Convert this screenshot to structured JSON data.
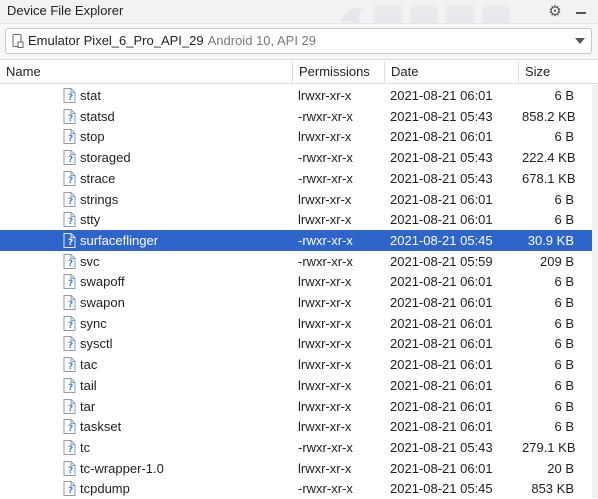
{
  "window": {
    "title": "Device File Explorer"
  },
  "device": {
    "name": "Emulator Pixel_6_Pro_API_29",
    "details": "Android 10, API 29"
  },
  "columns": {
    "name": "Name",
    "permissions": "Permissions",
    "date": "Date",
    "size": "Size"
  },
  "files": [
    {
      "name": "stat",
      "permissions": "lrwxr-xr-x",
      "date": "2021-08-21 06:01",
      "size": "6 B"
    },
    {
      "name": "statsd",
      "permissions": "-rwxr-xr-x",
      "date": "2021-08-21 05:43",
      "size": "858.2 KB"
    },
    {
      "name": "stop",
      "permissions": "lrwxr-xr-x",
      "date": "2021-08-21 06:01",
      "size": "6 B"
    },
    {
      "name": "storaged",
      "permissions": "-rwxr-xr-x",
      "date": "2021-08-21 05:43",
      "size": "222.4 KB"
    },
    {
      "name": "strace",
      "permissions": "-rwxr-xr-x",
      "date": "2021-08-21 05:43",
      "size": "678.1 KB"
    },
    {
      "name": "strings",
      "permissions": "lrwxr-xr-x",
      "date": "2021-08-21 06:01",
      "size": "6 B"
    },
    {
      "name": "stty",
      "permissions": "lrwxr-xr-x",
      "date": "2021-08-21 06:01",
      "size": "6 B"
    },
    {
      "name": "surfaceflinger",
      "permissions": "-rwxr-xr-x",
      "date": "2021-08-21 05:45",
      "size": "30.9 KB",
      "selected": true
    },
    {
      "name": "svc",
      "permissions": "-rwxr-xr-x",
      "date": "2021-08-21 05:59",
      "size": "209 B"
    },
    {
      "name": "swapoff",
      "permissions": "lrwxr-xr-x",
      "date": "2021-08-21 06:01",
      "size": "6 B"
    },
    {
      "name": "swapon",
      "permissions": "lrwxr-xr-x",
      "date": "2021-08-21 06:01",
      "size": "6 B"
    },
    {
      "name": "sync",
      "permissions": "lrwxr-xr-x",
      "date": "2021-08-21 06:01",
      "size": "6 B"
    },
    {
      "name": "sysctl",
      "permissions": "lrwxr-xr-x",
      "date": "2021-08-21 06:01",
      "size": "6 B"
    },
    {
      "name": "tac",
      "permissions": "lrwxr-xr-x",
      "date": "2021-08-21 06:01",
      "size": "6 B"
    },
    {
      "name": "tail",
      "permissions": "lrwxr-xr-x",
      "date": "2021-08-21 06:01",
      "size": "6 B"
    },
    {
      "name": "tar",
      "permissions": "lrwxr-xr-x",
      "date": "2021-08-21 06:01",
      "size": "6 B"
    },
    {
      "name": "taskset",
      "permissions": "lrwxr-xr-x",
      "date": "2021-08-21 06:01",
      "size": "6 B"
    },
    {
      "name": "tc",
      "permissions": "-rwxr-xr-x",
      "date": "2021-08-21 05:43",
      "size": "279.1 KB"
    },
    {
      "name": "tc-wrapper-1.0",
      "permissions": "lrwxr-xr-x",
      "date": "2021-08-21 06:01",
      "size": "20 B"
    },
    {
      "name": "tcpdump",
      "permissions": "-rwxr-xr-x",
      "date": "2021-08-21 05:45",
      "size": "853 KB"
    }
  ],
  "icons": {
    "file": "unknown-file-icon",
    "settings": "gear-icon",
    "hide": "minimize-icon",
    "device": "phone-icon"
  },
  "colors": {
    "selection": "#2f65ca",
    "titlebar": "#f2f2f2",
    "accent_file_icon": "#5b8fc9"
  }
}
